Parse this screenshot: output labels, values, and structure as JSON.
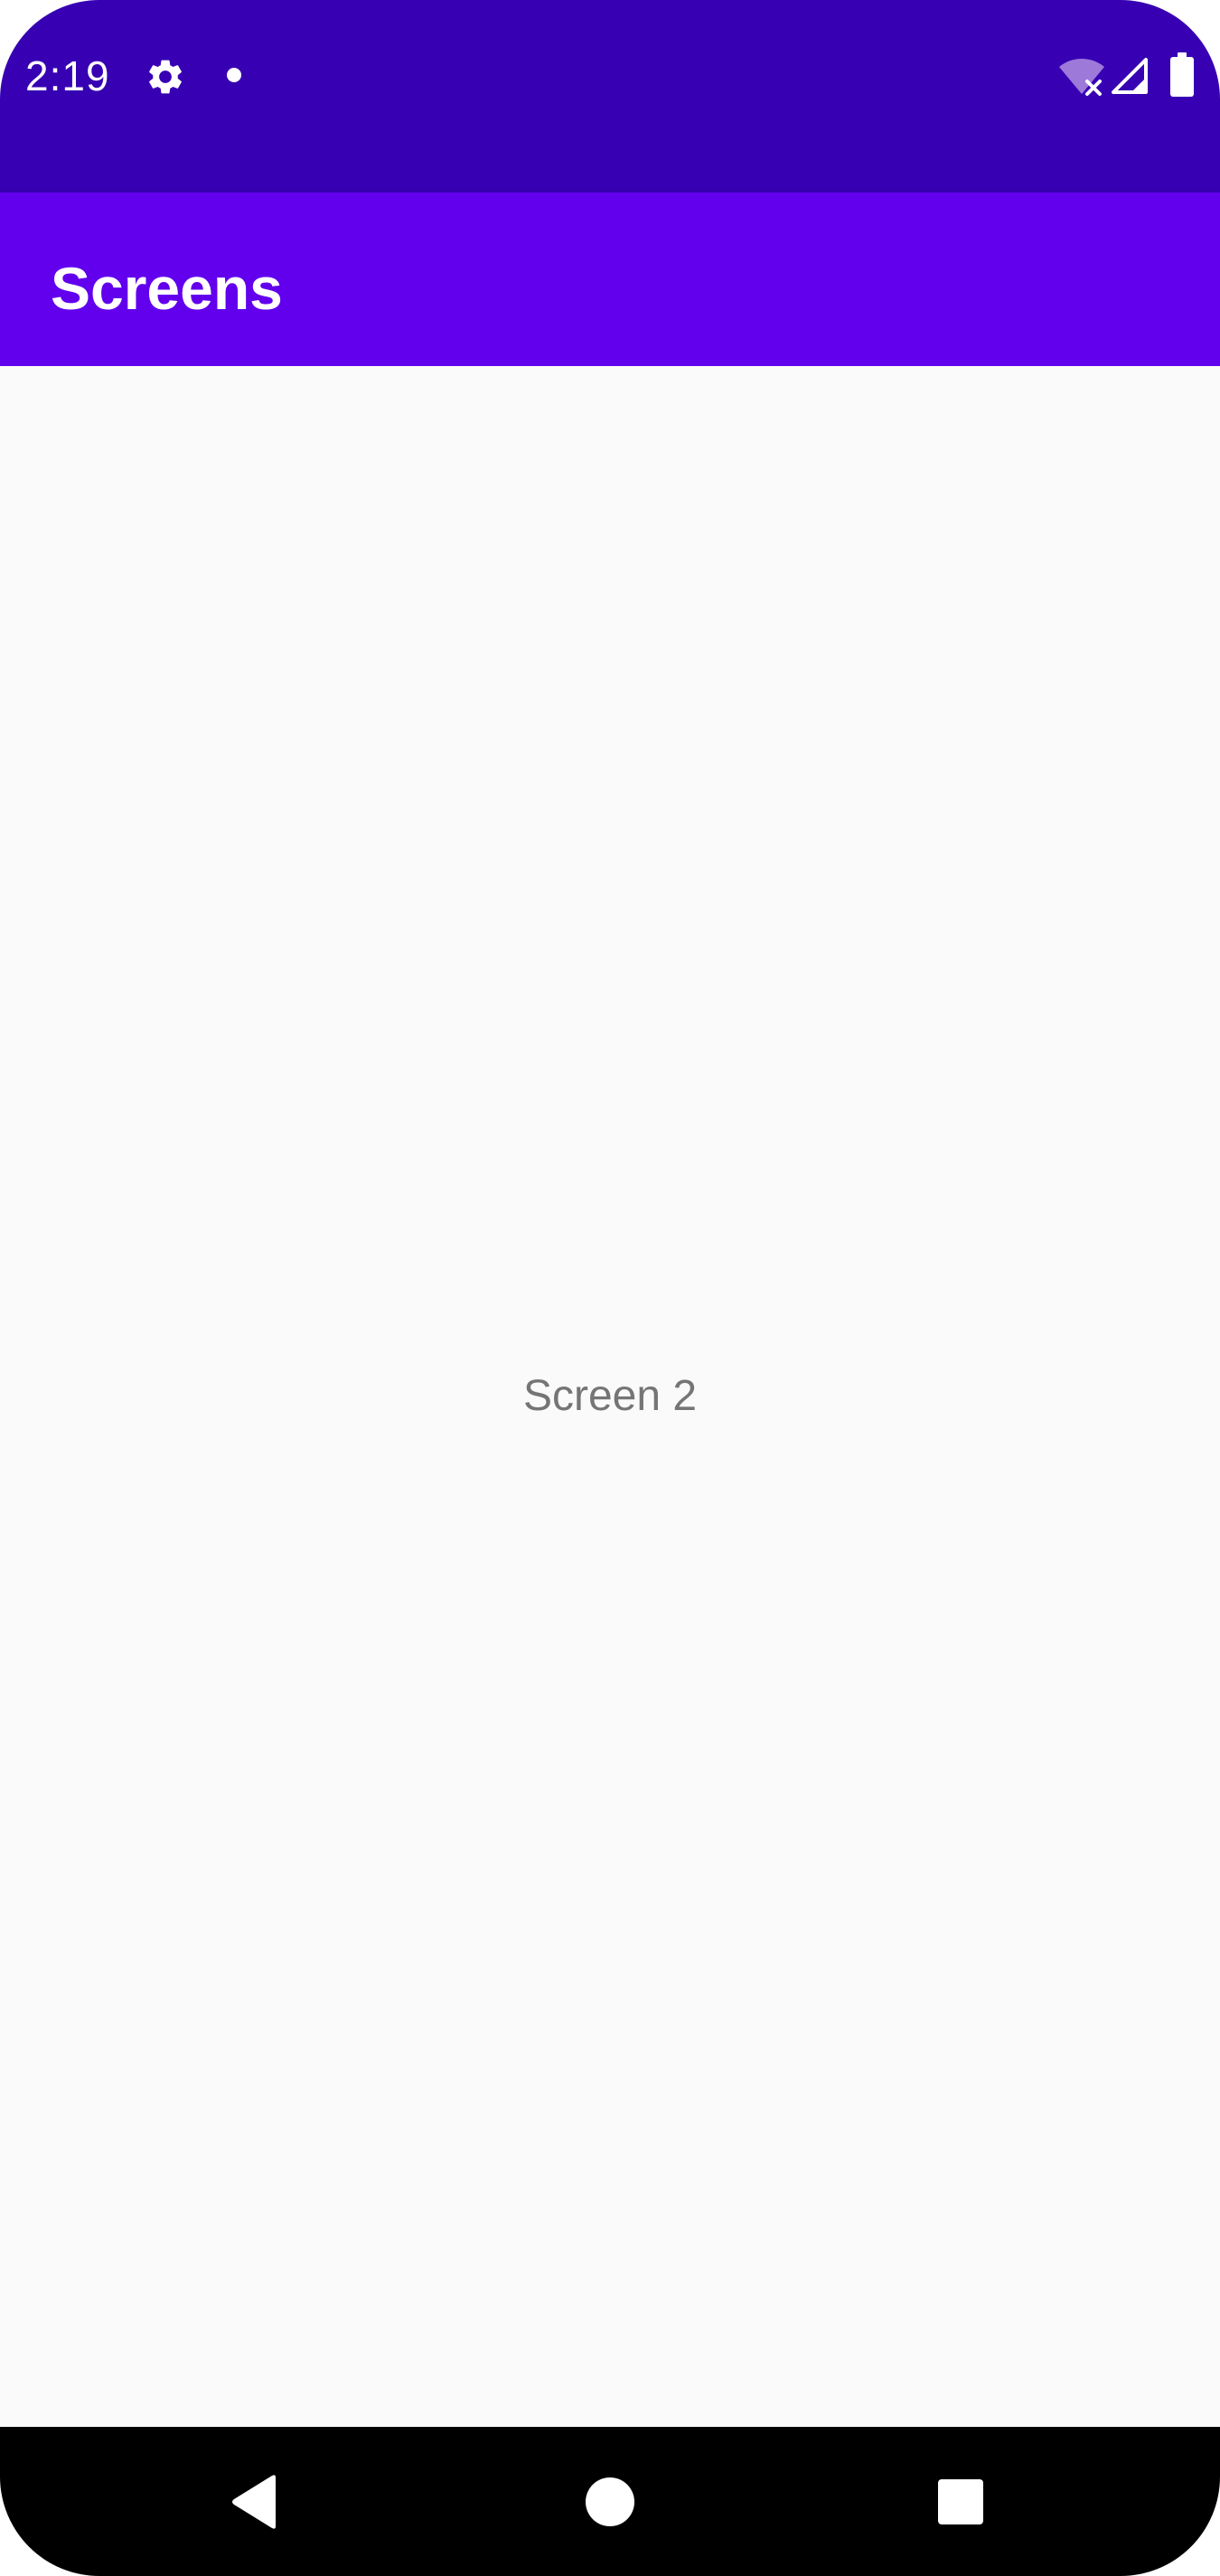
{
  "status_bar": {
    "time": "2:19",
    "icons": [
      "settings-icon",
      "notification-dot-icon",
      "wifi-off-icon",
      "cell-signal-icon",
      "battery-icon"
    ]
  },
  "app_bar": {
    "title": "Screens"
  },
  "main": {
    "label": "Screen 2"
  },
  "nav_bar": {
    "buttons": [
      "back-icon",
      "home-icon",
      "recents-icon"
    ]
  },
  "colors": {
    "status_bar": "#3700b3",
    "app_bar": "#6200ee",
    "background": "#fafafa",
    "label_text": "#757575",
    "nav_bar": "#000000"
  }
}
